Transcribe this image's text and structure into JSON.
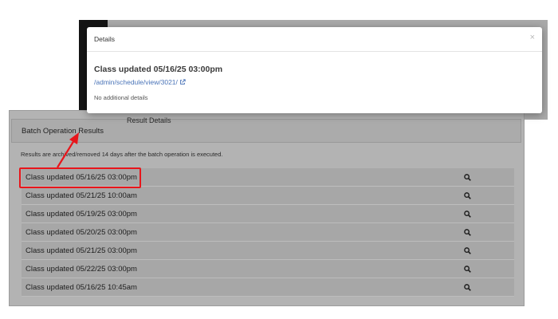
{
  "background_panel": {
    "behind_label": "Result Details",
    "title": "Batch Operation Results",
    "note": "Results are archived/removed 14 days after the batch operation is executed.",
    "results": [
      {
        "label": "Class updated 05/16/25 03:00pm"
      },
      {
        "label": "Class updated 05/21/25 10:00am"
      },
      {
        "label": "Class updated 05/19/25 03:00pm"
      },
      {
        "label": "Class updated 05/20/25 03:00pm"
      },
      {
        "label": "Class updated 05/21/25 03:00pm"
      },
      {
        "label": "Class updated 05/22/25 03:00pm"
      },
      {
        "label": "Class updated 05/16/25 10:45am"
      }
    ],
    "row_action_icon": "search-icon"
  },
  "modal": {
    "title": "Details",
    "close_symbol": "×",
    "heading": "Class updated 05/16/25 03:00pm",
    "link_text": "/admin/schedule/view/3021/",
    "link_icon": "external-link-icon",
    "note": "No additional details"
  },
  "colors": {
    "highlight": "#e8151b",
    "link": "#4a74b8",
    "overlay_gray": "#b3b3b3"
  }
}
